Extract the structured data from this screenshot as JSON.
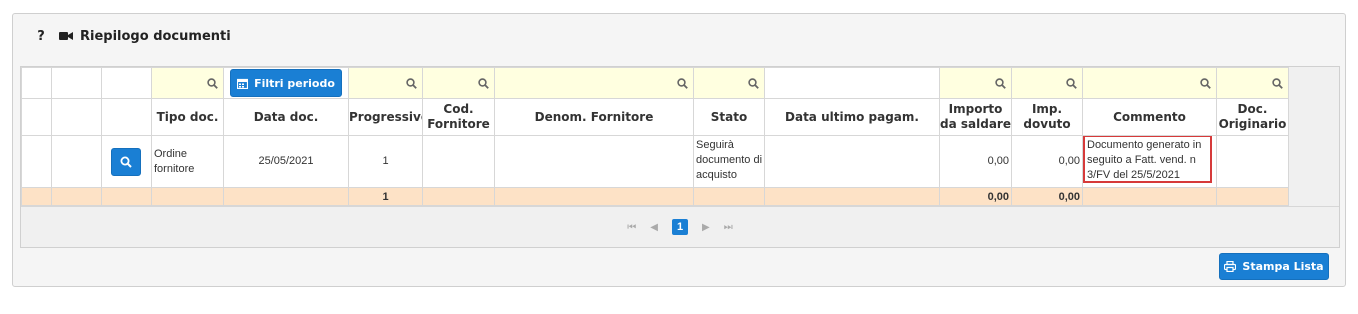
{
  "panel": {
    "help": "?",
    "camera_icon": "video-camera-icon",
    "title": "Riepilogo documenti"
  },
  "filters": {
    "period_button": "Filtri periodo",
    "period_icon": "calendar-icon",
    "search_icon": "magnifier-icon"
  },
  "columns": [
    "Tipo doc.",
    "Data doc.",
    "Progressivo",
    "Cod.\nFornitore",
    "Denom. Fornitore",
    "Stato",
    "Data ultimo pagam.",
    "Importo\nda saldare",
    "Imp.\ndovuto",
    "Commento",
    "Doc.\nOriginario"
  ],
  "row": {
    "tipo": "Ordine fornitore",
    "data": "25/05/2021",
    "progressivo": "1",
    "cod_fornitore": "",
    "denom_fornitore": "",
    "stato": "Seguirà documento di acquisto",
    "data_ultimo_pagam": "",
    "importo_da_saldare": "0,00",
    "imp_dovuto": "0,00",
    "commento": "Documento generato in seguito a Fatt. vend. n 3/FV del 25/5/2021",
    "doc_originario": ""
  },
  "totals": {
    "progressivo": "1",
    "importo_da_saldare": "0,00",
    "imp_dovuto": "0,00"
  },
  "pager": {
    "first": "⏮",
    "prev": "◀",
    "current": "1",
    "next": "▶",
    "last": "⏭"
  },
  "print_button": "Stampa Lista",
  "colors": {
    "primary": "#1a7fd4",
    "danger": "#e02a3f",
    "filter_bg": "#ffffe0",
    "total_bg": "#fde2c6",
    "highlight": "#d63a3a"
  }
}
